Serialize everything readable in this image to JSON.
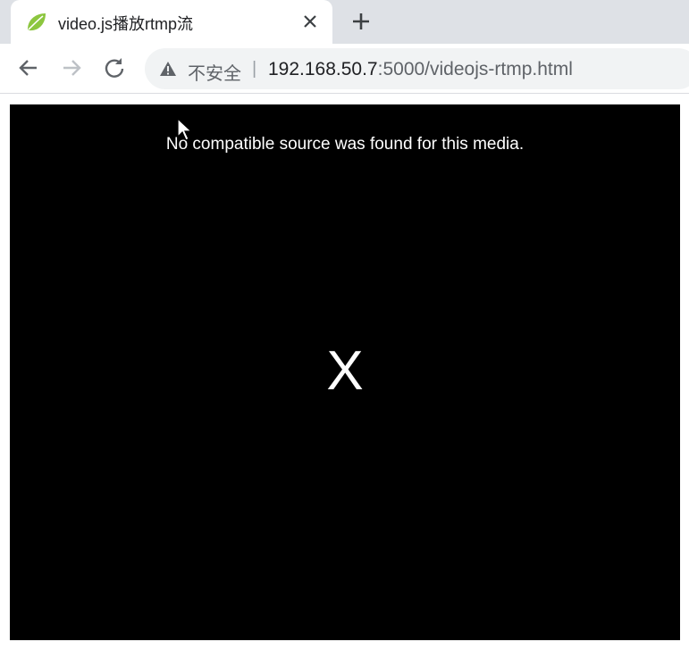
{
  "tab": {
    "title": "video.js播放rtmp流",
    "favicon": "spring-leaf-icon"
  },
  "addressbar": {
    "security_label": "不安全",
    "separator": "|",
    "url_host": "192.168.50.7",
    "url_rest": ":5000/videojs-rtmp.html"
  },
  "player": {
    "error_message": "No compatible source was found for this media.",
    "error_glyph": "X"
  },
  "colors": {
    "tabstrip": "#dee1e6",
    "player_bg": "#000000",
    "favicon_green": "#8cc63f"
  }
}
